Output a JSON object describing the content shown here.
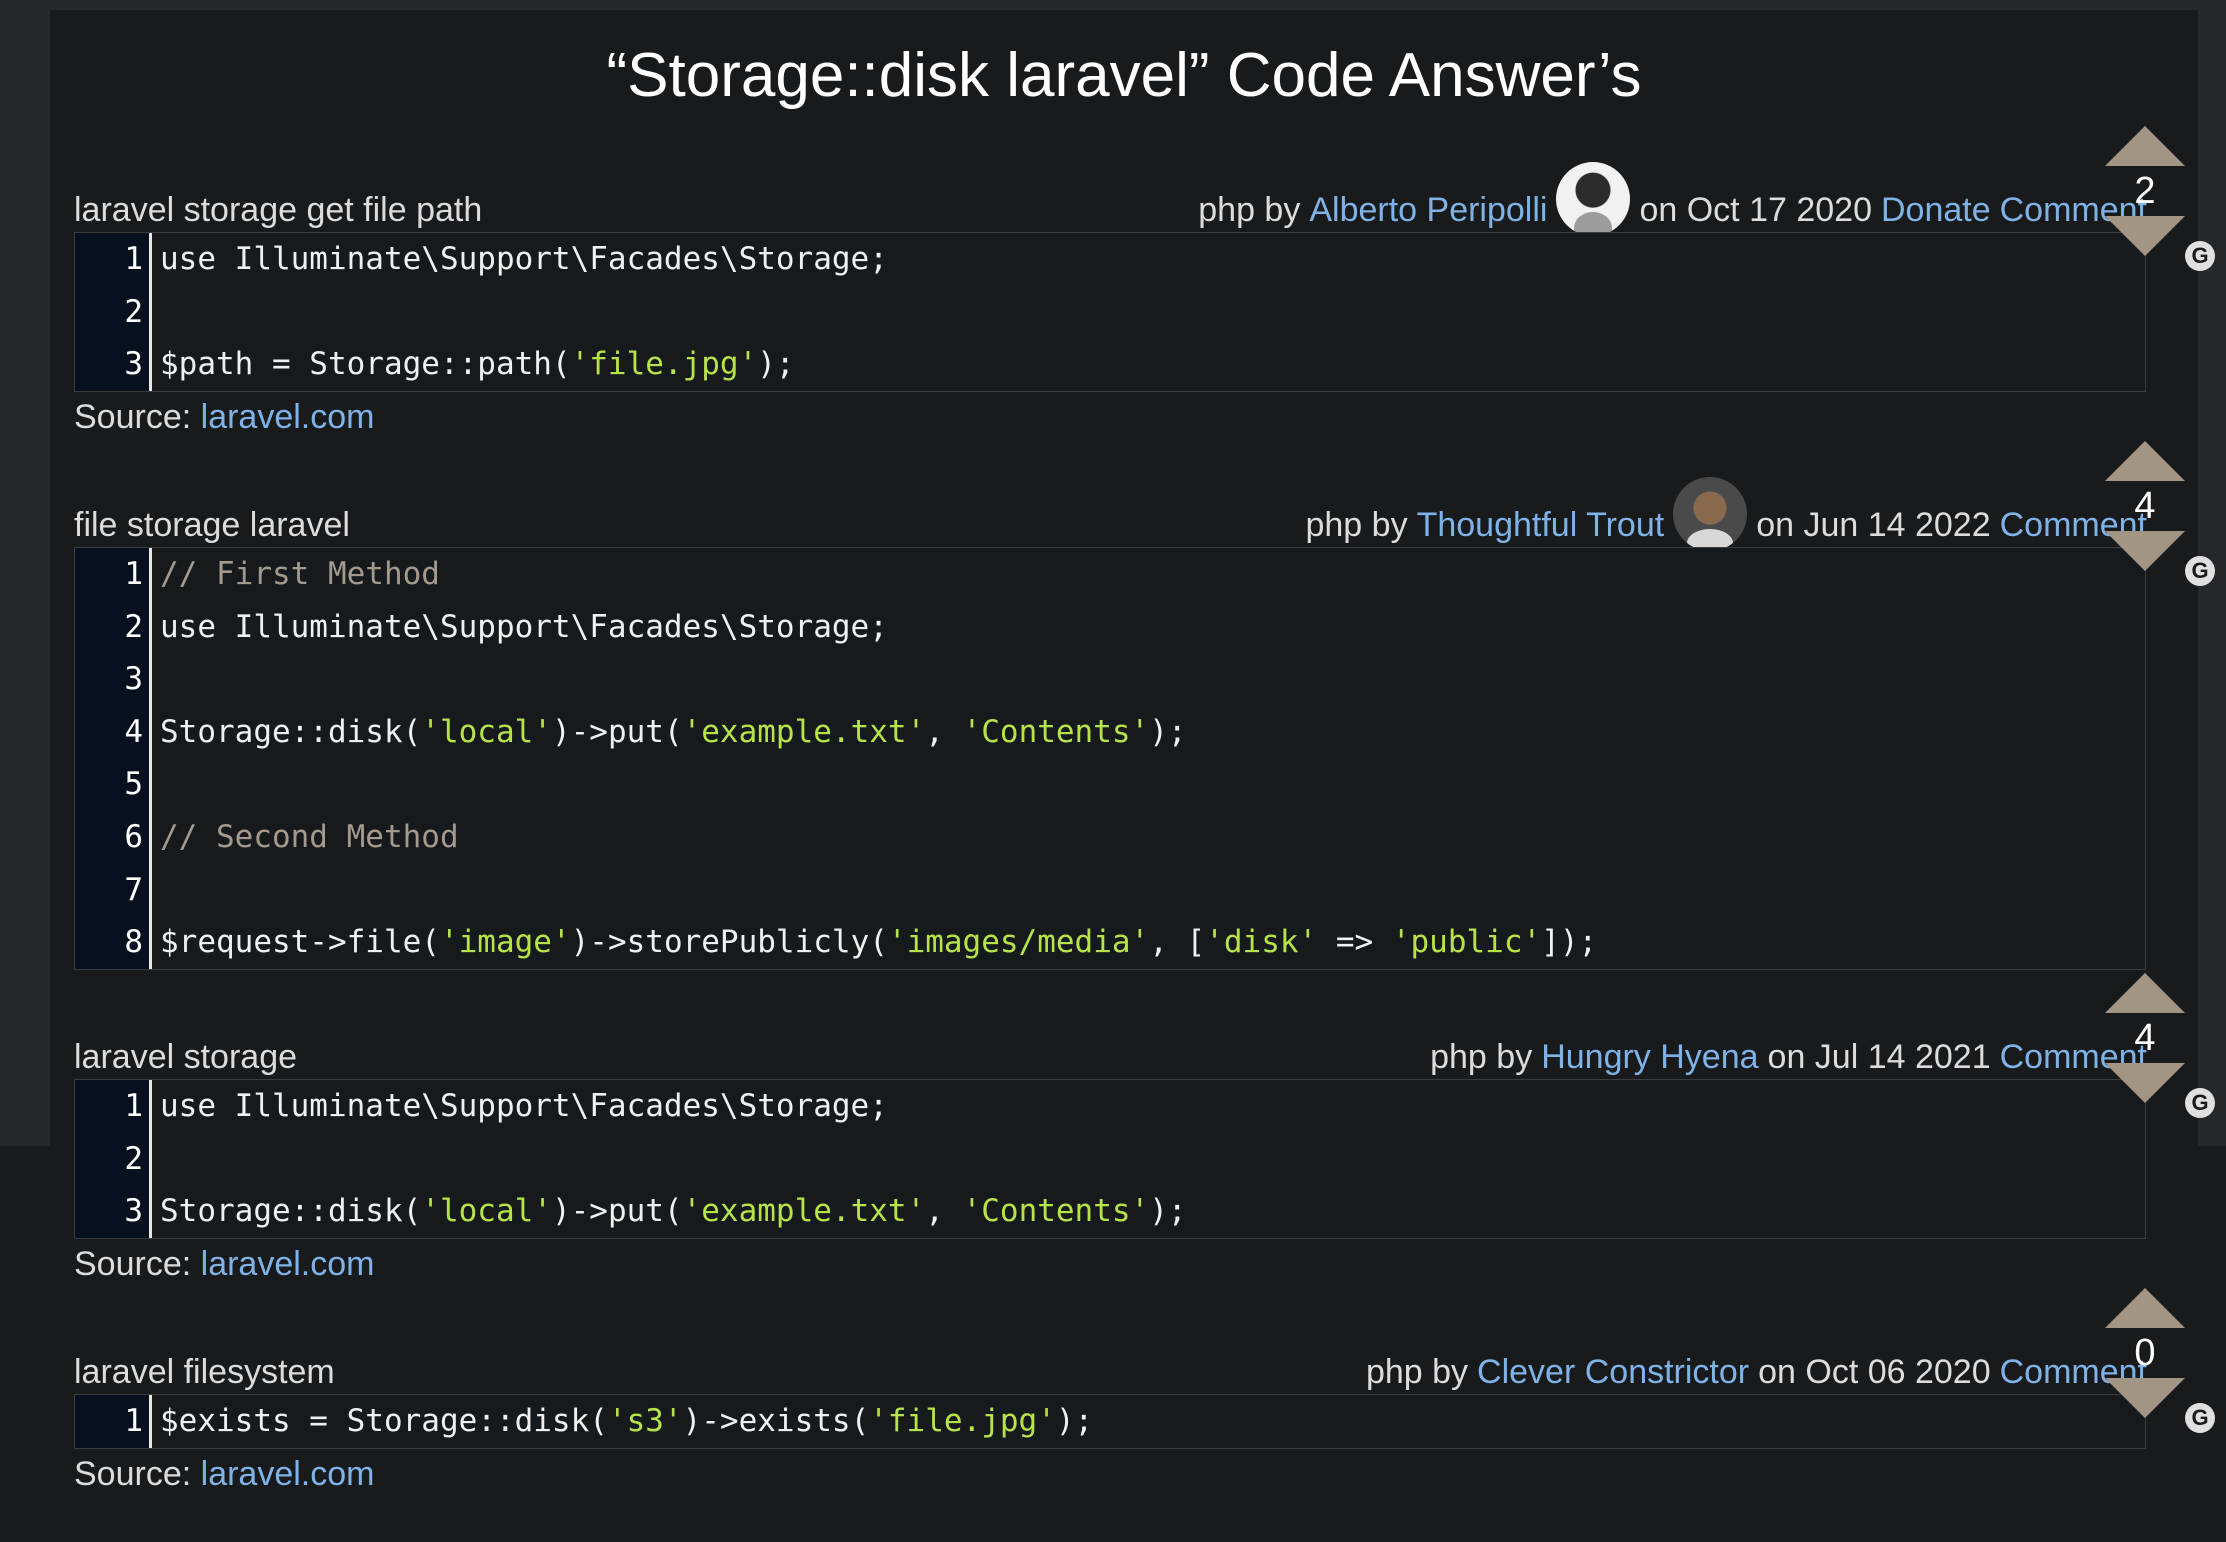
{
  "page_title": "“Storage::disk laravel” Code Answer’s",
  "answers": [
    {
      "question": "laravel storage get file path",
      "lang": "php by",
      "author": "Alberto Peripolli",
      "date": "on Oct 17 2020",
      "donate": "Donate",
      "comment": "Comment",
      "votes": "2",
      "source_label": "Source:",
      "source": "laravel.com",
      "line_numbers": [
        "1",
        "2",
        "3"
      ]
    },
    {
      "question": "file storage laravel",
      "lang": "php by",
      "author": "Thoughtful Trout",
      "date": "on Jun 14 2022",
      "comment": "Comment",
      "votes": "4",
      "line_numbers": [
        "1",
        "2",
        "3",
        "4",
        "5",
        "6",
        "7",
        "8"
      ]
    },
    {
      "question": "laravel storage",
      "lang": "php by",
      "author": "Hungry Hyena",
      "date": "on Jul 14 2021",
      "comment": "Comment",
      "votes": "4",
      "source_label": "Source:",
      "source": "laravel.com",
      "line_numbers": [
        "1",
        "2",
        "3"
      ]
    },
    {
      "question": "laravel filesystem",
      "lang": "php by",
      "author": "Clever Constrictor",
      "date": "on Oct 06 2020",
      "comment": "Comment",
      "votes": "0",
      "source_label": "Source:",
      "source": "laravel.com",
      "line_numbers": [
        "1"
      ]
    }
  ],
  "code": {
    "use_storage": "use Illuminate\\Support\\Facades\\Storage;",
    "path_a": "$path = Storage::path(",
    "path_s": "'file.jpg'",
    "path_b": ");",
    "c_first": "// First Method",
    "disk": "Storage::disk(",
    "local": "'local'",
    "put": ")->put(",
    "example": "'example.txt'",
    "comma": ", ",
    "contents": "'Contents'",
    "close": ");",
    "c_second": "// Second Method",
    "req_a": "$request->file(",
    "image": "'image'",
    "req_b": ")->storePublicly(",
    "images_media": "'images/media'",
    "req_c": ", [",
    "disk_key": "'disk'",
    "arrow": " => ",
    "public": "'public'",
    "req_d": "]);",
    "exists_a": "$exists = Storage::disk(",
    "s3": "'s3'",
    "exists_b": ")->exists(",
    "file_jpg": "'file.jpg'",
    "exists_c": ");"
  },
  "icons": {
    "upvote": "up-arrow-icon",
    "downvote": "down-arrow-icon",
    "grepper": "grepper-icon",
    "avatar": "avatar-image"
  },
  "colors": {
    "background": "#191b1d",
    "link": "#7fb3e8",
    "string": "#b7e34a",
    "comment": "#a39a8d",
    "vote_arrow": "#a39583"
  }
}
